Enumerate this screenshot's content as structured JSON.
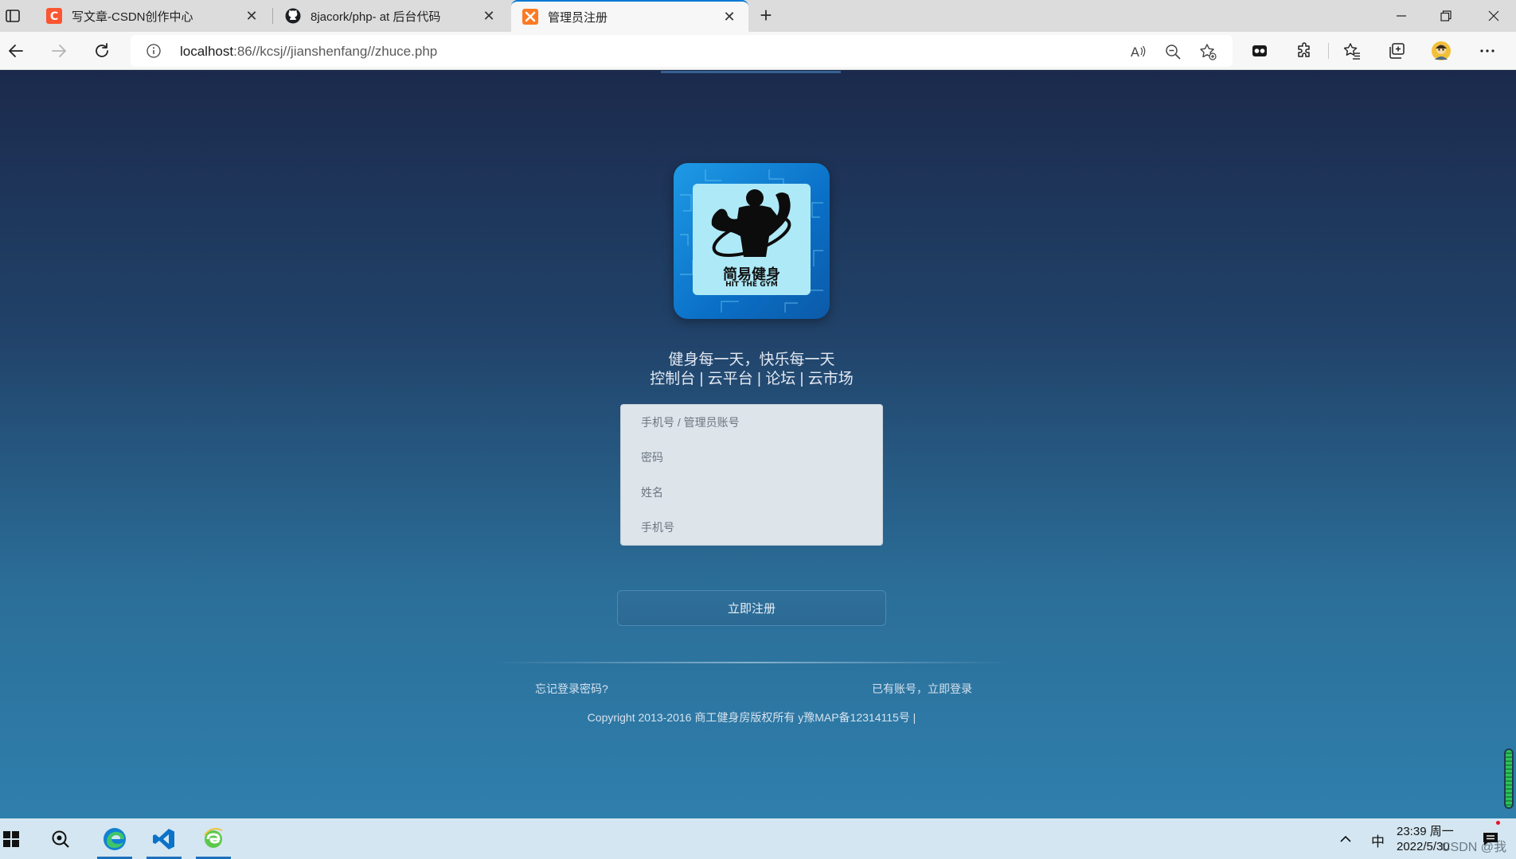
{
  "browser": {
    "tabs": [
      {
        "title": "写文章-CSDN创作中心",
        "close": "✕"
      },
      {
        "title": "8jacork/php- at 后台代码",
        "close": "✕"
      },
      {
        "title": "管理员注册",
        "close": "✕"
      }
    ],
    "new_tab": "+",
    "address": {
      "host": "localhost",
      "path": ":86//kcsj//jianshenfang//zhuce.php"
    }
  },
  "page": {
    "logo": {
      "cn": "简易健身",
      "en": "HIT THE GYM"
    },
    "slogan": "健身每一天，快乐每一天",
    "nav_links": "控制台 | 云平台 | 论坛 | 云市场",
    "form": {
      "account_placeholder": "手机号 / 管理员账号",
      "password_placeholder": "密码",
      "name_placeholder": "姓名",
      "phone_placeholder": "手机号"
    },
    "register_label": "立即注册",
    "forgot_label": "忘记登录密码?",
    "login_label": "已有账号，立即登录",
    "copyright": "Copyright 2013-2016 商工健身房版权所有 y豫MAP备12314115号 |"
  },
  "taskbar": {
    "ime": "中",
    "time": "23:39 周一",
    "date": "2022/5/30",
    "watermark": "CSDN @我的猴子"
  },
  "colors": {
    "accent": "#0078d4",
    "page_top": "#1b2a4c",
    "page_bottom": "#2f7fad"
  }
}
